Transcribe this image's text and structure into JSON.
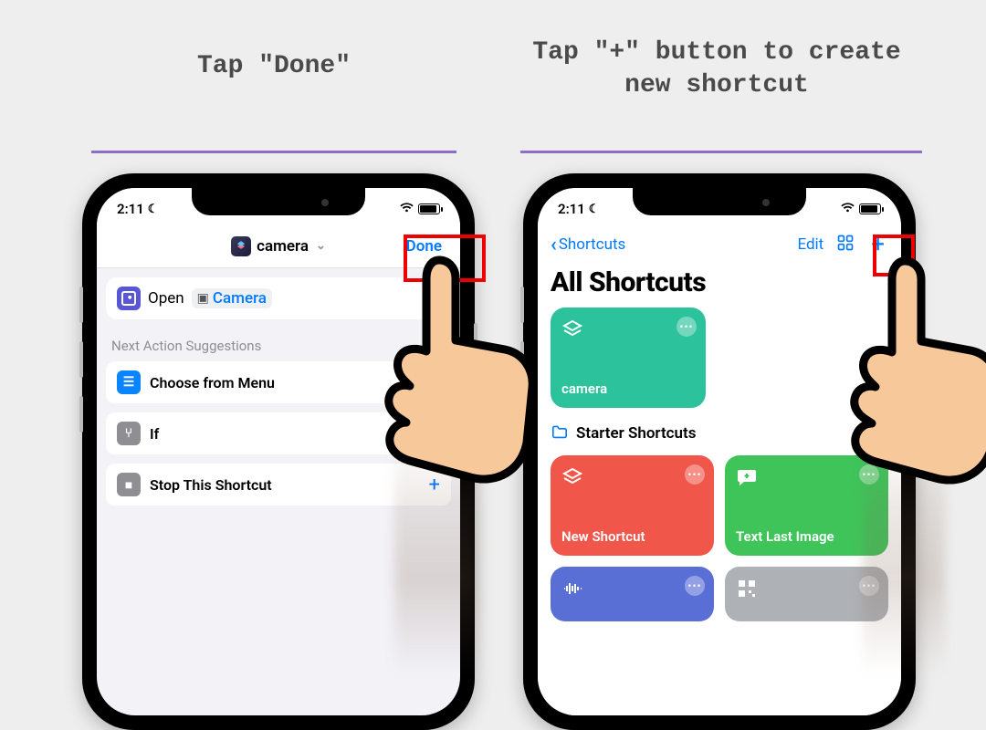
{
  "captions": {
    "left": "Tap \"Done\"",
    "right": "Tap \"+\" button to create new shortcut"
  },
  "status": {
    "time": "2:11"
  },
  "screen1": {
    "title": "camera",
    "done": "Done",
    "action_open": "Open",
    "action_app": "Camera",
    "suggestions_header": "Next Action Suggestions",
    "suggestions": [
      {
        "label": "Choose from Menu"
      },
      {
        "label": "If"
      },
      {
        "label": "Stop This Shortcut"
      }
    ]
  },
  "screen2": {
    "back_label": "Shortcuts",
    "edit": "Edit",
    "heading": "All Shortcuts",
    "tile_camera": "camera",
    "section_starter": "Starter Shortcuts",
    "tiles": [
      {
        "label": "New Shortcut"
      },
      {
        "label": "Text Last Image"
      }
    ]
  }
}
